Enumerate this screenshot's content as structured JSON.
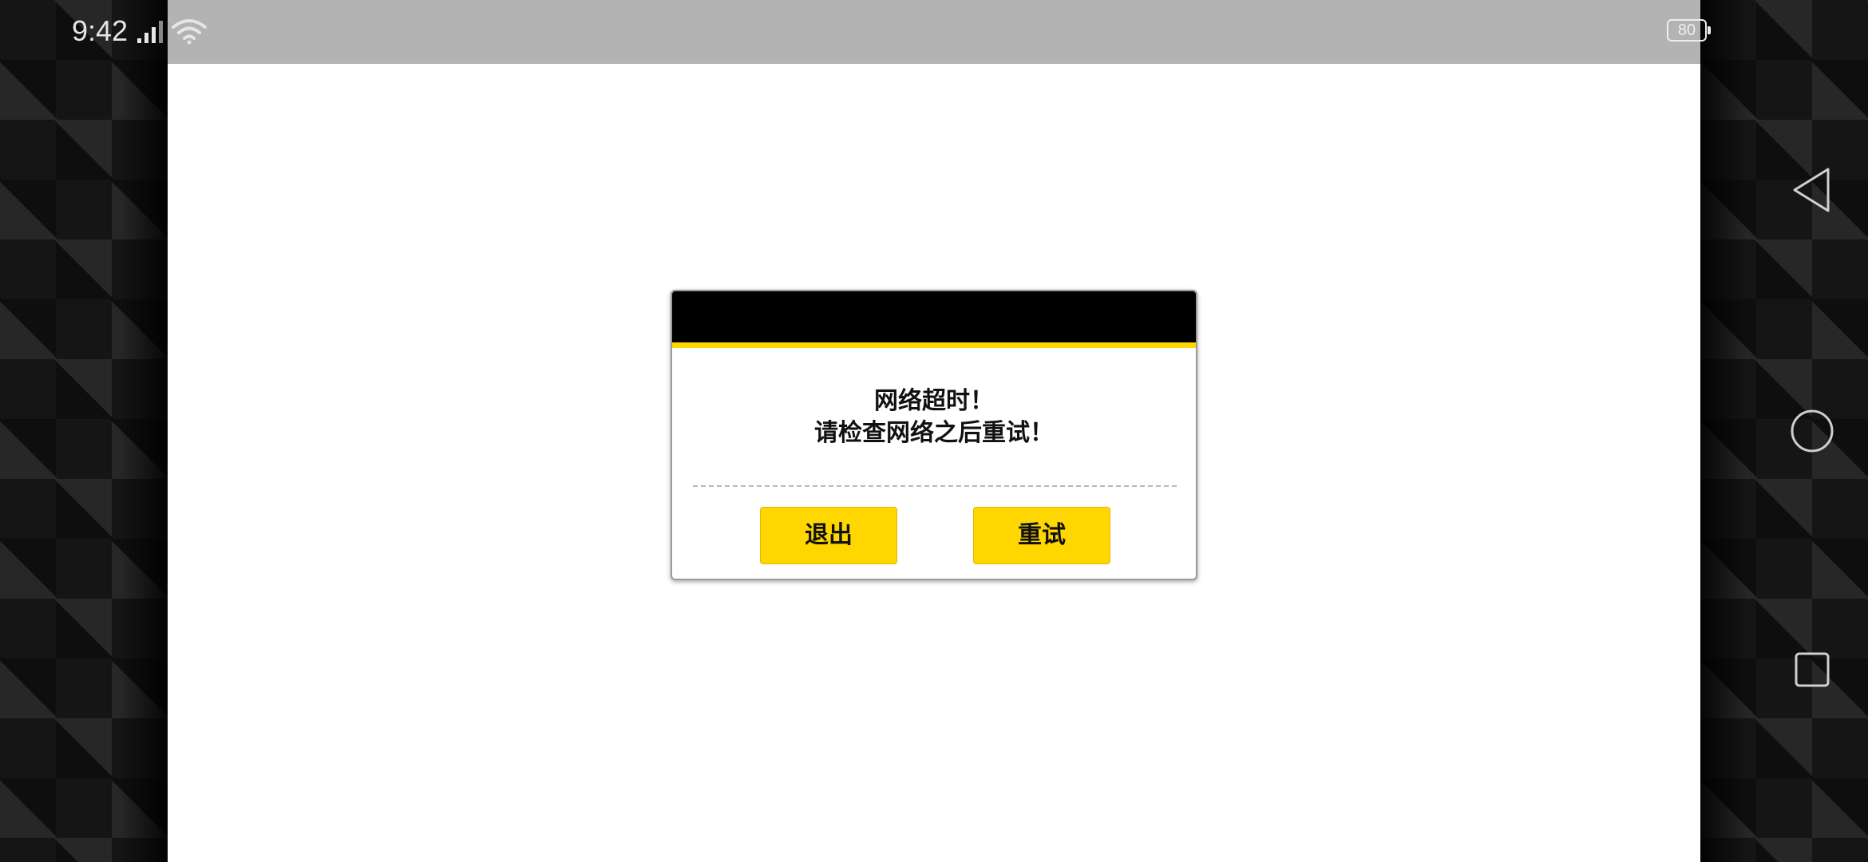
{
  "status_bar": {
    "time": "9:42",
    "battery_level": "80",
    "icons": [
      "signal-icon",
      "wifi-icon",
      "battery-icon"
    ]
  },
  "navigation_bar": {
    "icons": [
      "back-icon",
      "home-icon",
      "recents-icon"
    ]
  },
  "dialog": {
    "message_line1": "网络超时！",
    "message_line2": "请检查网络之后重试！",
    "exit_label": "退出",
    "retry_label": "重试"
  },
  "colors": {
    "accent": "#ffd700",
    "header": "#000000",
    "status_bar": "#b3b3b3",
    "content_background": "#ffffff"
  }
}
